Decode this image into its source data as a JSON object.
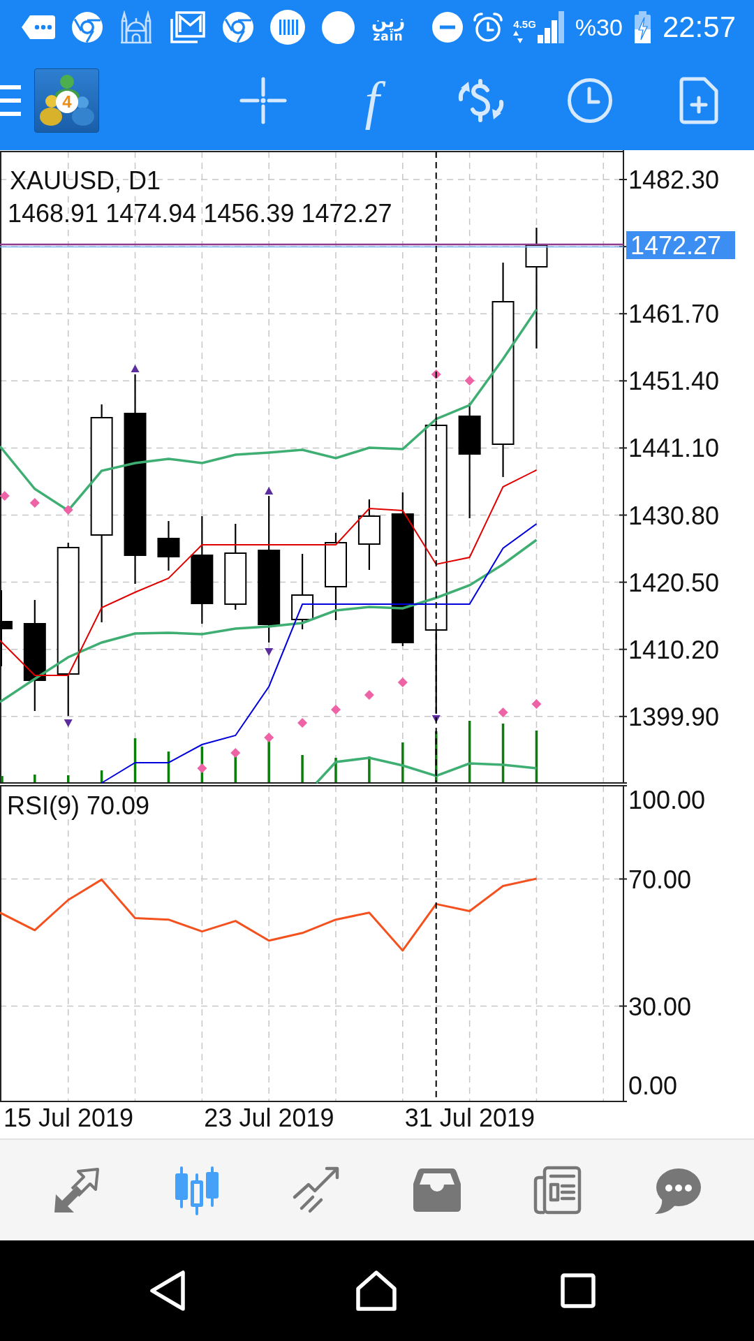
{
  "status_bar": {
    "carrier_arabic": "زين",
    "carrier_latin": "zain",
    "network": "4.5G",
    "battery": "%30",
    "time": "22:57"
  },
  "toolbar": {
    "logo_badge": "4",
    "indicators_glyph": "f"
  },
  "chart": {
    "symbol": "XAUUSD, D1",
    "ohlc": "1468.91 1474.94 1456.39 1472.27",
    "price_labels": [
      "1482.30",
      "1461.70",
      "1451.40",
      "1441.10",
      "1430.80",
      "1420.50",
      "1410.20",
      "1399.90"
    ],
    "current_price": "1472.27"
  },
  "rsi": {
    "title": "RSI(9) 70.09",
    "axis_labels": [
      "100.00",
      "70.00",
      "30.00",
      "0.00"
    ]
  },
  "time_axis": {
    "labels": [
      "15 Jul 2019",
      "23 Jul 2019",
      "31 Jul 2019"
    ]
  },
  "bottom_nav": [
    {
      "selected": false
    },
    {
      "selected": true
    },
    {
      "selected": false
    },
    {
      "selected": false
    },
    {
      "selected": false
    },
    {
      "selected": false
    }
  ]
}
